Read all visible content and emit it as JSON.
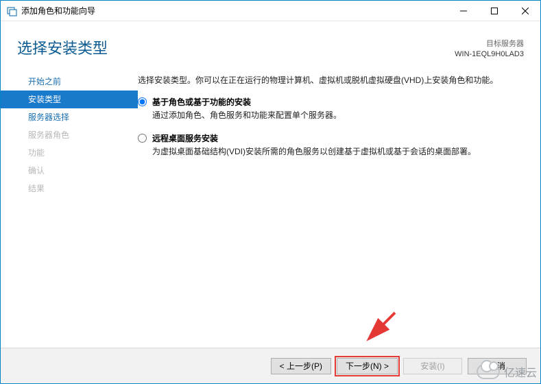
{
  "window": {
    "title": "添加角色和功能向导"
  },
  "header": {
    "title": "选择安装类型",
    "target_label": "目标服务器",
    "target_server": "WIN-1EQL9H0LAD3"
  },
  "sidebar": {
    "steps": [
      {
        "label": "开始之前",
        "state": "enabled"
      },
      {
        "label": "安装类型",
        "state": "active"
      },
      {
        "label": "服务器选择",
        "state": "enabled"
      },
      {
        "label": "服务器角色",
        "state": "disabled"
      },
      {
        "label": "功能",
        "state": "disabled"
      },
      {
        "label": "确认",
        "state": "disabled"
      },
      {
        "label": "结果",
        "state": "disabled"
      }
    ]
  },
  "content": {
    "instruction": "选择安装类型。你可以在正在运行的物理计算机、虚拟机或脱机虚拟硬盘(VHD)上安装角色和功能。",
    "options": [
      {
        "title": "基于角色或基于功能的安装",
        "desc": "通过添加角色、角色服务和功能来配置单个服务器。",
        "selected": true
      },
      {
        "title": "远程桌面服务安装",
        "desc": "为虚拟桌面基础结构(VDI)安装所需的角色服务以创建基于虚拟机或基于会话的桌面部署。",
        "selected": false
      }
    ]
  },
  "footer": {
    "previous": "< 上一步(P)",
    "next": "下一步(N) >",
    "install": "安装(I)",
    "cancel": "取消"
  },
  "watermark": "亿速云"
}
